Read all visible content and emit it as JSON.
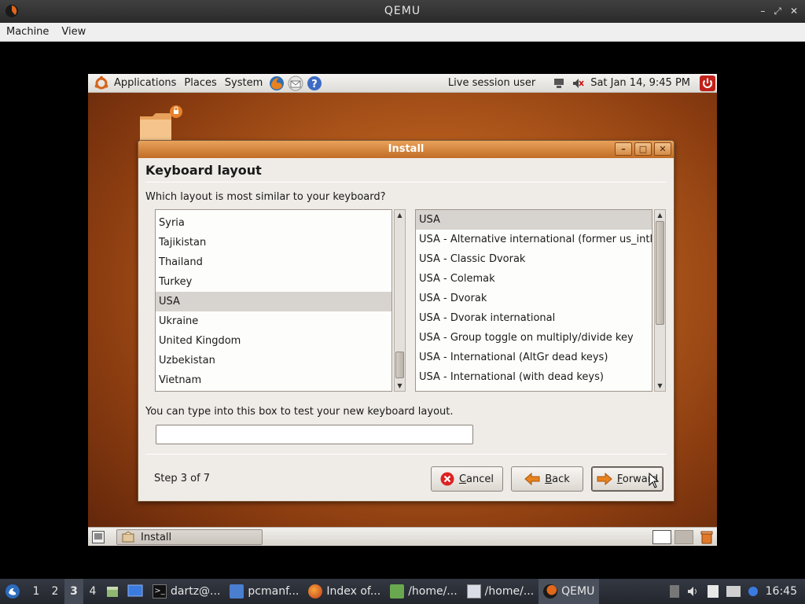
{
  "qemu": {
    "title": "QEMU",
    "menu": [
      "Machine",
      "View"
    ],
    "controls": [
      "–",
      "⤢",
      "✕"
    ]
  },
  "guest_panel": {
    "menus": [
      "Applications",
      "Places",
      "System"
    ],
    "user": "Live session user",
    "clock": "Sat Jan 14,  9:45 PM"
  },
  "dialog": {
    "title": "Install",
    "heading": "Keyboard layout",
    "question": "Which layout is most similar to your keyboard?",
    "countries": [
      "Syria",
      "Tajikistan",
      "Thailand",
      "Turkey",
      "USA",
      "Ukraine",
      "United Kingdom",
      "Uzbekistan",
      "Vietnam"
    ],
    "selected_country": "USA",
    "variants": [
      "USA",
      "USA - Alternative international (former us_intl)",
      "USA - Classic Dvorak",
      "USA - Colemak",
      "USA - Dvorak",
      "USA - Dvorak international",
      "USA - Group toggle on multiply/divide key",
      "USA - International (AltGr dead keys)",
      "USA - International (with dead keys)"
    ],
    "selected_variant": "USA",
    "test_label": "You can type into this box to test your new keyboard layout.",
    "test_value": "",
    "step": "Step 3 of 7",
    "buttons": {
      "cancel_mnemonic": "C",
      "cancel_rest": "ancel",
      "back_mnemonic": "B",
      "back_rest": "ack",
      "forward_mnemonic": "F",
      "forward_rest": "orward"
    }
  },
  "guest_bottom": {
    "task_label": "Install"
  },
  "host_taskbar": {
    "workspaces": [
      "1",
      "2",
      "3",
      "4"
    ],
    "active_workspace": "3",
    "tasks": [
      {
        "label": "dartz@...",
        "icon": "terminal-icon"
      },
      {
        "label": "pcmanf...",
        "icon": "folder-icon"
      },
      {
        "label": "Index of...",
        "icon": "firefox-icon"
      },
      {
        "label": "/home/...",
        "icon": "leafpad-icon"
      },
      {
        "label": "/home/...",
        "icon": "text-editor-icon"
      },
      {
        "label": "QEMU",
        "icon": "qemu-icon"
      }
    ],
    "clock": "16:45"
  },
  "colors": {
    "dialog_titlebar": "#c97730",
    "host_taskbar": "#2b2e35",
    "selection": "#d7d3ce"
  }
}
